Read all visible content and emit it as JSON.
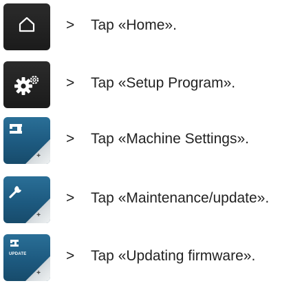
{
  "colors": {
    "dark_icon_bg": "#1b1b1b",
    "blue_icon_bg": "#1d5a80",
    "text": "#222222"
  },
  "steps": [
    {
      "arrow": ">",
      "text": "Tap «Home».",
      "icon": "home-icon"
    },
    {
      "arrow": ">",
      "text": "Tap «Setup Program».",
      "icon": "gears-icon"
    },
    {
      "arrow": ">",
      "text": "Tap «Machine Settings».",
      "icon": "sewing-machine-icon",
      "icon_plus": "+"
    },
    {
      "arrow": ">",
      "text": "Tap «Maintenance/update».",
      "icon": "wrench-icon",
      "icon_plus": "+"
    },
    {
      "arrow": ">",
      "text": "Tap «Updating firmware».",
      "icon": "update-icon",
      "icon_label": "UPDATE",
      "icon_plus": "+"
    }
  ]
}
